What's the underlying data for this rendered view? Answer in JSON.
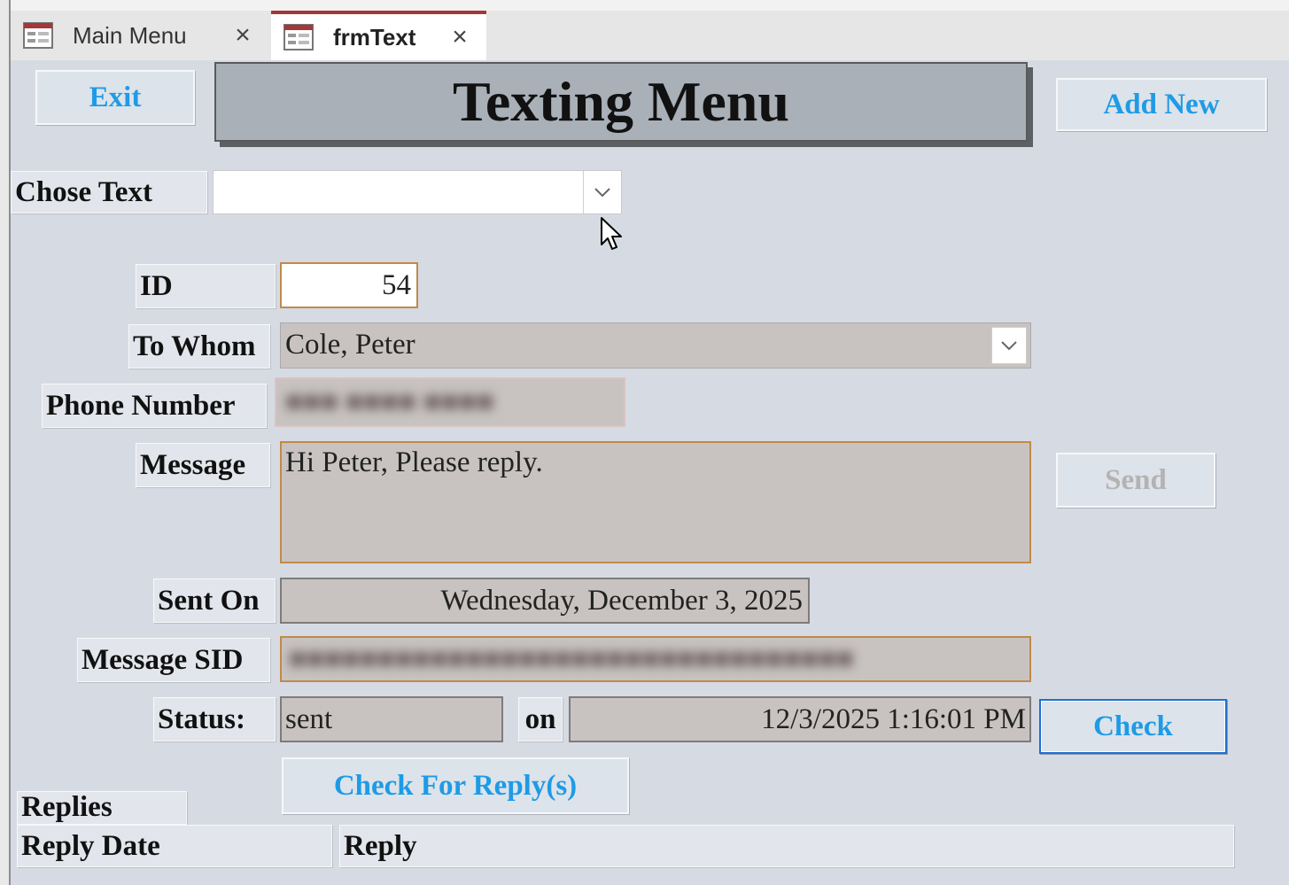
{
  "tabs": [
    {
      "label": "Main Menu",
      "active": false
    },
    {
      "label": "frmText",
      "active": true
    }
  ],
  "header": {
    "exit_label": "Exit",
    "title": "Texting Menu",
    "add_new_label": "Add New"
  },
  "chose_text": {
    "label": "Chose Text",
    "value": ""
  },
  "record": {
    "id_label": "ID",
    "id_value": "54",
    "to_whom_label": "To Whom",
    "to_whom_value": "Cole, Peter",
    "phone_label": "Phone Number",
    "phone_value": "■■■ ■■■■ ■■■■",
    "message_label": "Message",
    "message_value": "Hi Peter, Please reply.",
    "send_label": "Send",
    "sent_on_label": "Sent On",
    "sent_on_value": "Wednesday, December 3, 2025",
    "message_sid_label": "Message SID",
    "message_sid_value": "■■■■■■■■■■■■■■■■■■■■■■■■■■■■■■■■",
    "status_label": "Status:",
    "status_value": "sent",
    "on_label": "on",
    "status_date_value": "12/3/2025 1:16:01 PM",
    "check_label": "Check",
    "check_replies_label": "Check For Reply(s)"
  },
  "replies": {
    "section_label": "Replies",
    "columns": [
      "Reply Date",
      "Reply"
    ]
  },
  "colors": {
    "accent_button_text": "#1e9be6",
    "active_tab_border": "#a4373a",
    "field_border": "#c18a4a"
  }
}
